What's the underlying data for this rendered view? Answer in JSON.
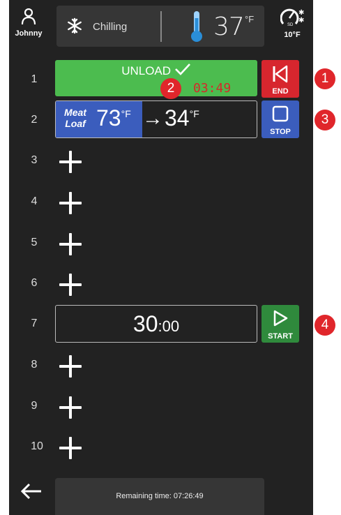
{
  "header": {
    "user_name": "Johnny",
    "mode": "Chilling",
    "temperature": "37",
    "temperature_unit": "°F",
    "sensor_label": "SD",
    "sensor_temp": "10°F"
  },
  "rows": [
    {
      "number": "1",
      "type": "unload",
      "label": "UNLOAD",
      "timer": "03:49",
      "button": "END",
      "badge": "1",
      "timer_badge": "2"
    },
    {
      "number": "2",
      "type": "probe",
      "product_line1": "Meat",
      "product_line2": "Loaf",
      "current_temp": "73",
      "target_temp": "34",
      "unit": "°F",
      "button": "STOP",
      "badge": "3"
    },
    {
      "number": "3",
      "type": "add"
    },
    {
      "number": "4",
      "type": "add"
    },
    {
      "number": "5",
      "type": "add"
    },
    {
      "number": "6",
      "type": "add"
    },
    {
      "number": "7",
      "type": "timer",
      "minutes": "30",
      "seconds": ":00",
      "button": "START",
      "badge": "4"
    },
    {
      "number": "8",
      "type": "add"
    },
    {
      "number": "9",
      "type": "add"
    },
    {
      "number": "10",
      "type": "add"
    }
  ],
  "footer": {
    "remaining_time": "Remaining time: 07:26:49"
  },
  "colors": {
    "background": "#222222",
    "unload_green": "#4cbc4f",
    "end_red": "#d7262e",
    "stop_blue": "#3b5dbd",
    "start_green": "#2f8a3c",
    "badge_red": "#e0262b"
  },
  "icons": [
    "user-icon",
    "snowflake-icon",
    "thermometer-icon",
    "speedometer-icon",
    "checkmark-icon",
    "skip-back-icon",
    "stop-icon",
    "play-icon",
    "plus-icon",
    "back-arrow-icon"
  ],
  "probe_progress": 0.43
}
